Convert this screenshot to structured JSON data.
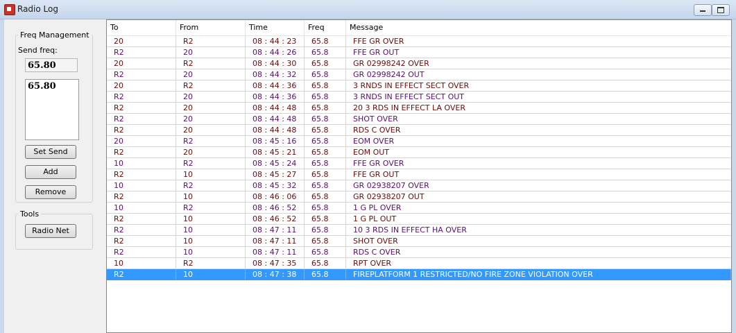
{
  "window": {
    "title": "Radio Log"
  },
  "freq_management": {
    "legend": "Freq Management",
    "send_freq_label": "Send freq:",
    "send_freq_value": "65.80",
    "freq_list": [
      "65.80"
    ],
    "buttons": {
      "set_send": "Set Send",
      "add": "Add",
      "remove": "Remove"
    }
  },
  "tools": {
    "legend": "Tools",
    "radio_net": "Radio Net"
  },
  "table": {
    "columns": [
      "To",
      "From",
      "Time",
      "Freq",
      "Message"
    ],
    "selected_index": 21,
    "rows": [
      {
        "to": "20",
        "from": "R2",
        "time": "08 : 44 : 23",
        "freq": "65.8",
        "message": "FFE GR OVER"
      },
      {
        "to": "R2",
        "from": "20",
        "time": "08 : 44 : 26",
        "freq": "65.8",
        "message": "FFE GR OUT"
      },
      {
        "to": "20",
        "from": "R2",
        "time": "08 : 44 : 30",
        "freq": "65.8",
        "message": "GR 02998242 OVER"
      },
      {
        "to": "R2",
        "from": "20",
        "time": "08 : 44 : 32",
        "freq": "65.8",
        "message": "GR 02998242 OUT"
      },
      {
        "to": "20",
        "from": "R2",
        "time": "08 : 44 : 36",
        "freq": "65.8",
        "message": "3 RNDS IN EFFECT SECT OVER"
      },
      {
        "to": "R2",
        "from": "20",
        "time": "08 : 44 : 36",
        "freq": "65.8",
        "message": "3 RNDS IN EFFECT SECT OUT"
      },
      {
        "to": "R2",
        "from": "20",
        "time": "08 : 44 : 48",
        "freq": "65.8",
        "message": "20 3 RDS IN EFFECT LA OVER"
      },
      {
        "to": "R2",
        "from": "20",
        "time": "08 : 44 : 48",
        "freq": "65.8",
        "message": "SHOT OVER"
      },
      {
        "to": "R2",
        "from": "20",
        "time": "08 : 44 : 48",
        "freq": "65.8",
        "message": "RDS C OVER"
      },
      {
        "to": "20",
        "from": "R2",
        "time": "08 : 45 : 16",
        "freq": "65.8",
        "message": "EOM OVER"
      },
      {
        "to": "R2",
        "from": "20",
        "time": "08 : 45 : 21",
        "freq": "65.8",
        "message": "EOM OUT"
      },
      {
        "to": "10",
        "from": "R2",
        "time": "08 : 45 : 24",
        "freq": "65.8",
        "message": "FFE GR OVER"
      },
      {
        "to": "R2",
        "from": "10",
        "time": "08 : 45 : 27",
        "freq": "65.8",
        "message": "FFE GR OUT"
      },
      {
        "to": "10",
        "from": "R2",
        "time": "08 : 45 : 32",
        "freq": "65.8",
        "message": "GR 02938207 OVER"
      },
      {
        "to": "R2",
        "from": "10",
        "time": "08 : 46 : 06",
        "freq": "65.8",
        "message": "GR 02938207 OUT"
      },
      {
        "to": "10",
        "from": "R2",
        "time": "08 : 46 : 52",
        "freq": "65.8",
        "message": "1 G PL OVER"
      },
      {
        "to": "R2",
        "from": "10",
        "time": "08 : 46 : 52",
        "freq": "65.8",
        "message": "1 G PL OUT"
      },
      {
        "to": "R2",
        "from": "10",
        "time": "08 : 47 : 11",
        "freq": "65.8",
        "message": "10 3 RDS IN EFFECT HA OVER"
      },
      {
        "to": "R2",
        "from": "10",
        "time": "08 : 47 : 11",
        "freq": "65.8",
        "message": "SHOT OVER"
      },
      {
        "to": "R2",
        "from": "10",
        "time": "08 : 47 : 11",
        "freq": "65.8",
        "message": "RDS C OVER"
      },
      {
        "to": "10",
        "from": "R2",
        "time": "08 : 47 : 35",
        "freq": "65.8",
        "message": "RPT OVER"
      },
      {
        "to": "R2",
        "from": "10",
        "time": "08 : 47 : 38",
        "freq": "65.8",
        "message": "FIREPLATFORM 1 RESTRICTED/NO FIRE ZONE VIOLATION OVER"
      }
    ]
  },
  "colors": {
    "selection": "#3399ff",
    "row_text_a": "#6b0a0a",
    "row_text_b": "#5a0e6e"
  },
  "icons": {
    "app": "radio-log-app-icon",
    "minimize": "minimize-icon",
    "maximize": "maximize-icon"
  }
}
